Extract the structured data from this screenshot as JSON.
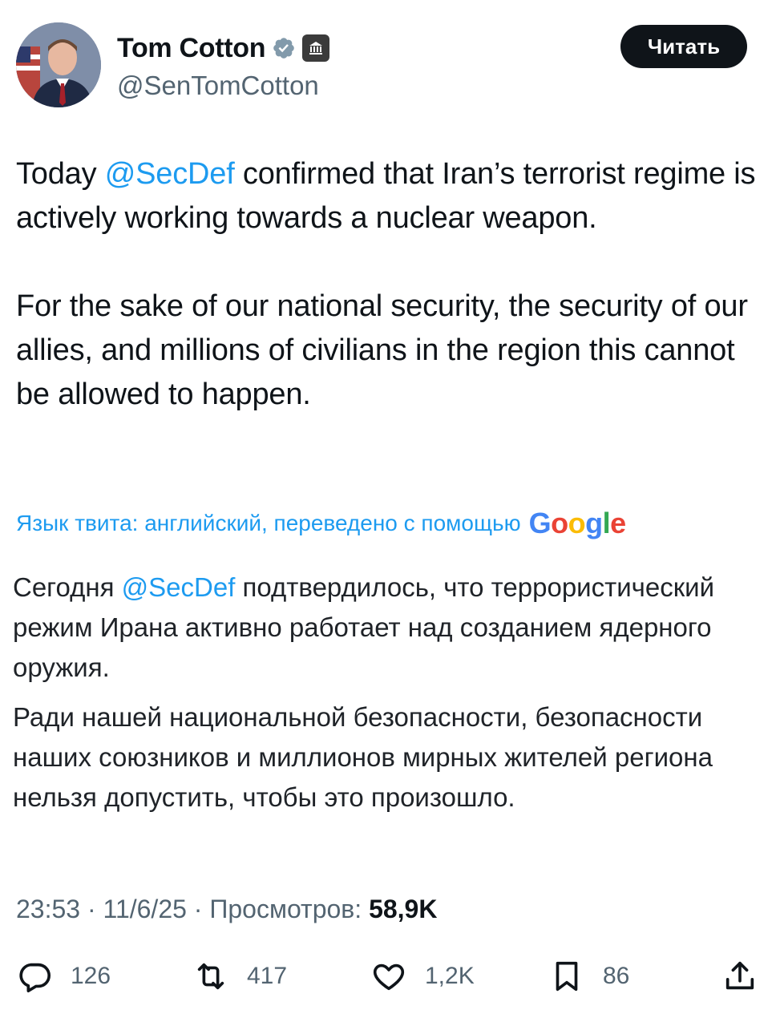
{
  "author": {
    "display_name": "Tom Cotton",
    "handle": "@SenTomCotton",
    "verified_icon": "verified-badge-icon",
    "affiliation_icon": "government-building-icon"
  },
  "follow_button": {
    "label": "Читать"
  },
  "tweet": {
    "p1_before": "Today ",
    "p1_mention": "@SecDef",
    "p1_after": " confirmed that Iran’s terrorist regime is actively working towards a nuclear weapon.",
    "p2": "For the sake of our national security, the security of our allies, and millions of civilians in the region this cannot be allowed to happen."
  },
  "translation": {
    "note": "Язык твита: английский, переведено с помощью",
    "provider": "Google",
    "p1_before": "Сегодня ",
    "p1_mention": "@SecDef",
    "p1_after": " подтвердилось, что террористический режим Ирана активно работает над созданием ядерного оружия.",
    "p2": "Ради нашей национальной безопасности, безопасности наших союзников и миллионов мирных жителей региона нельзя допустить, чтобы это произошло."
  },
  "meta": {
    "time": "23:53",
    "date": "11/6/25",
    "views_label": "Просмотров:",
    "views": "58,9K",
    "sep": " · "
  },
  "actions": {
    "replies": "126",
    "reposts": "417",
    "likes": "1,2K",
    "bookmarks": "86"
  },
  "colors": {
    "accent": "#1d9bf0",
    "text": "#0f1419",
    "secondary": "#536471"
  }
}
